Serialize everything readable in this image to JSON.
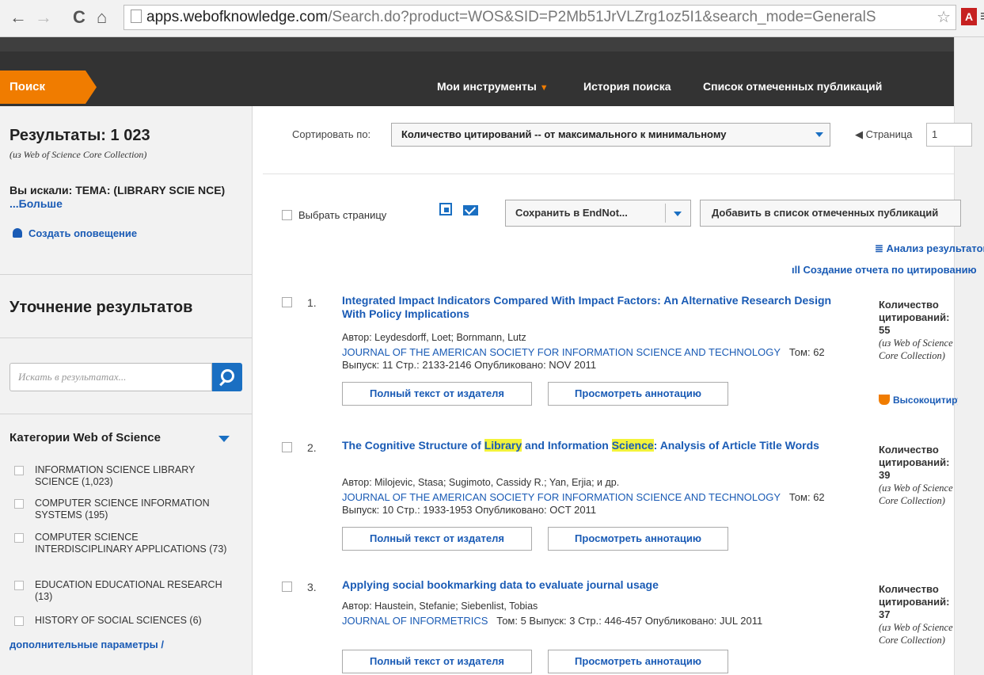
{
  "browser": {
    "back": "←",
    "forward": "→",
    "reload": "C",
    "home": "⌂",
    "url_host": "apps.webofknowledge.com",
    "url_path": "/Search.do?product=WOS&SID=P2Mb51JrVLZrg1oz5I1&search_mode=GeneralS",
    "star": "☆",
    "ext_label": "A",
    "menu": "≡"
  },
  "topnav": {
    "search_tab": "Поиск",
    "my_tools": "Мои инструменты",
    "tools_caret": "▼",
    "history": "История поиска",
    "marked_list": "Список отмеченных публикаций"
  },
  "sidebar": {
    "results_title": "Результаты: 1 023",
    "results_source": "(из Web of Science Core Collection)",
    "query_label": "Вы искали:",
    "query_text": "ТЕМА: (LIBRARY SCIE NCE)",
    "query_more": "...Больше",
    "create_alert": "Создать оповещение",
    "refine_title": "Уточнение результатов",
    "search_placeholder": "Искать в результатах...",
    "categories_title": "Категории Web of Science",
    "categories": [
      {
        "label": "INFORMATION SCIENCE LIBRARY SCIENCE (1,023)"
      },
      {
        "label": "COMPUTER SCIENCE INFORMATION SYSTEMS (195)"
      },
      {
        "label": "COMPUTER SCIENCE INTERDISCIPLINARY APPLICATIONS (73)"
      },
      {
        "label": "EDUCATION EDUCATIONAL RESEARCH (13)"
      },
      {
        "label": "HISTORY OF SOCIAL SCIENCES (6)"
      }
    ],
    "more_options": "дополнительные параметры /"
  },
  "sort": {
    "label": "Сортировать по:",
    "selected": "Количество цитирований -- от максимального к минимальному",
    "page_label": "◀ Страница",
    "page_value": "1"
  },
  "toolbar": {
    "select_page": "Выбрать страницу",
    "save_endnote": "Сохранить в EndNot...",
    "add_marked": "Добавить в список отмеченных публикаций",
    "analyze": "≣ Анализ результатов",
    "citation_report": "ıll Создание отчета по цитированию"
  },
  "records": [
    {
      "num": "1.",
      "title": "Integrated Impact Indicators Compared With Impact Factors: An Alternative Research Design With Policy Implications",
      "authors": "Автор: Leydesdorff, Loet; Bornmann, Lutz",
      "journal": "JOURNAL OF THE AMERICAN SOCIETY FOR INFORMATION SCIENCE AND TECHNOLOGY",
      "meta": "Том: 62   Выпуск: 11   Стр.: 2133-2146   Опубликовано: NOV 2011",
      "cite_label": "Количество цитирований: 55",
      "cite_src": "(из Web of Science Core Collection)",
      "hot": "Высокоцитируемый документ"
    },
    {
      "num": "2.",
      "title_a": "The Cognitive Structure of ",
      "title_hl1": "Library",
      "title_b": " and Information ",
      "title_hl2": "Science",
      "title_c": ": Analysis of Article Title Words",
      "authors": "Автор: Milojevic, Stasa; Sugimoto, Cassidy R.; Yan, Erjia; и др.",
      "journal": "JOURNAL OF THE AMERICAN SOCIETY FOR INFORMATION SCIENCE AND TECHNOLOGY",
      "meta": "Том: 62   Выпуск: 10   Стр.: 1933-1953   Опубликовано: OCT 2011",
      "cite_label": "Количество цитирований: 39",
      "cite_src": "(из Web of Science Core Collection)"
    },
    {
      "num": "3.",
      "title": "Applying social bookmarking data to evaluate journal usage",
      "authors": "Автор: Haustein, Stefanie; Siebenlist, Tobias",
      "journal": "JOURNAL OF INFORMETRICS",
      "meta": "Том: 5   Выпуск: 3   Стр.: 446-457   Опубликовано: JUL 2011",
      "cite_label": "Количество цитирований: 37",
      "cite_src": "(из Web of Science Core Collection)"
    }
  ],
  "record_buttons": {
    "full_text": "Полный текст от издателя",
    "abstract": "Просмотреть аннотацию"
  }
}
